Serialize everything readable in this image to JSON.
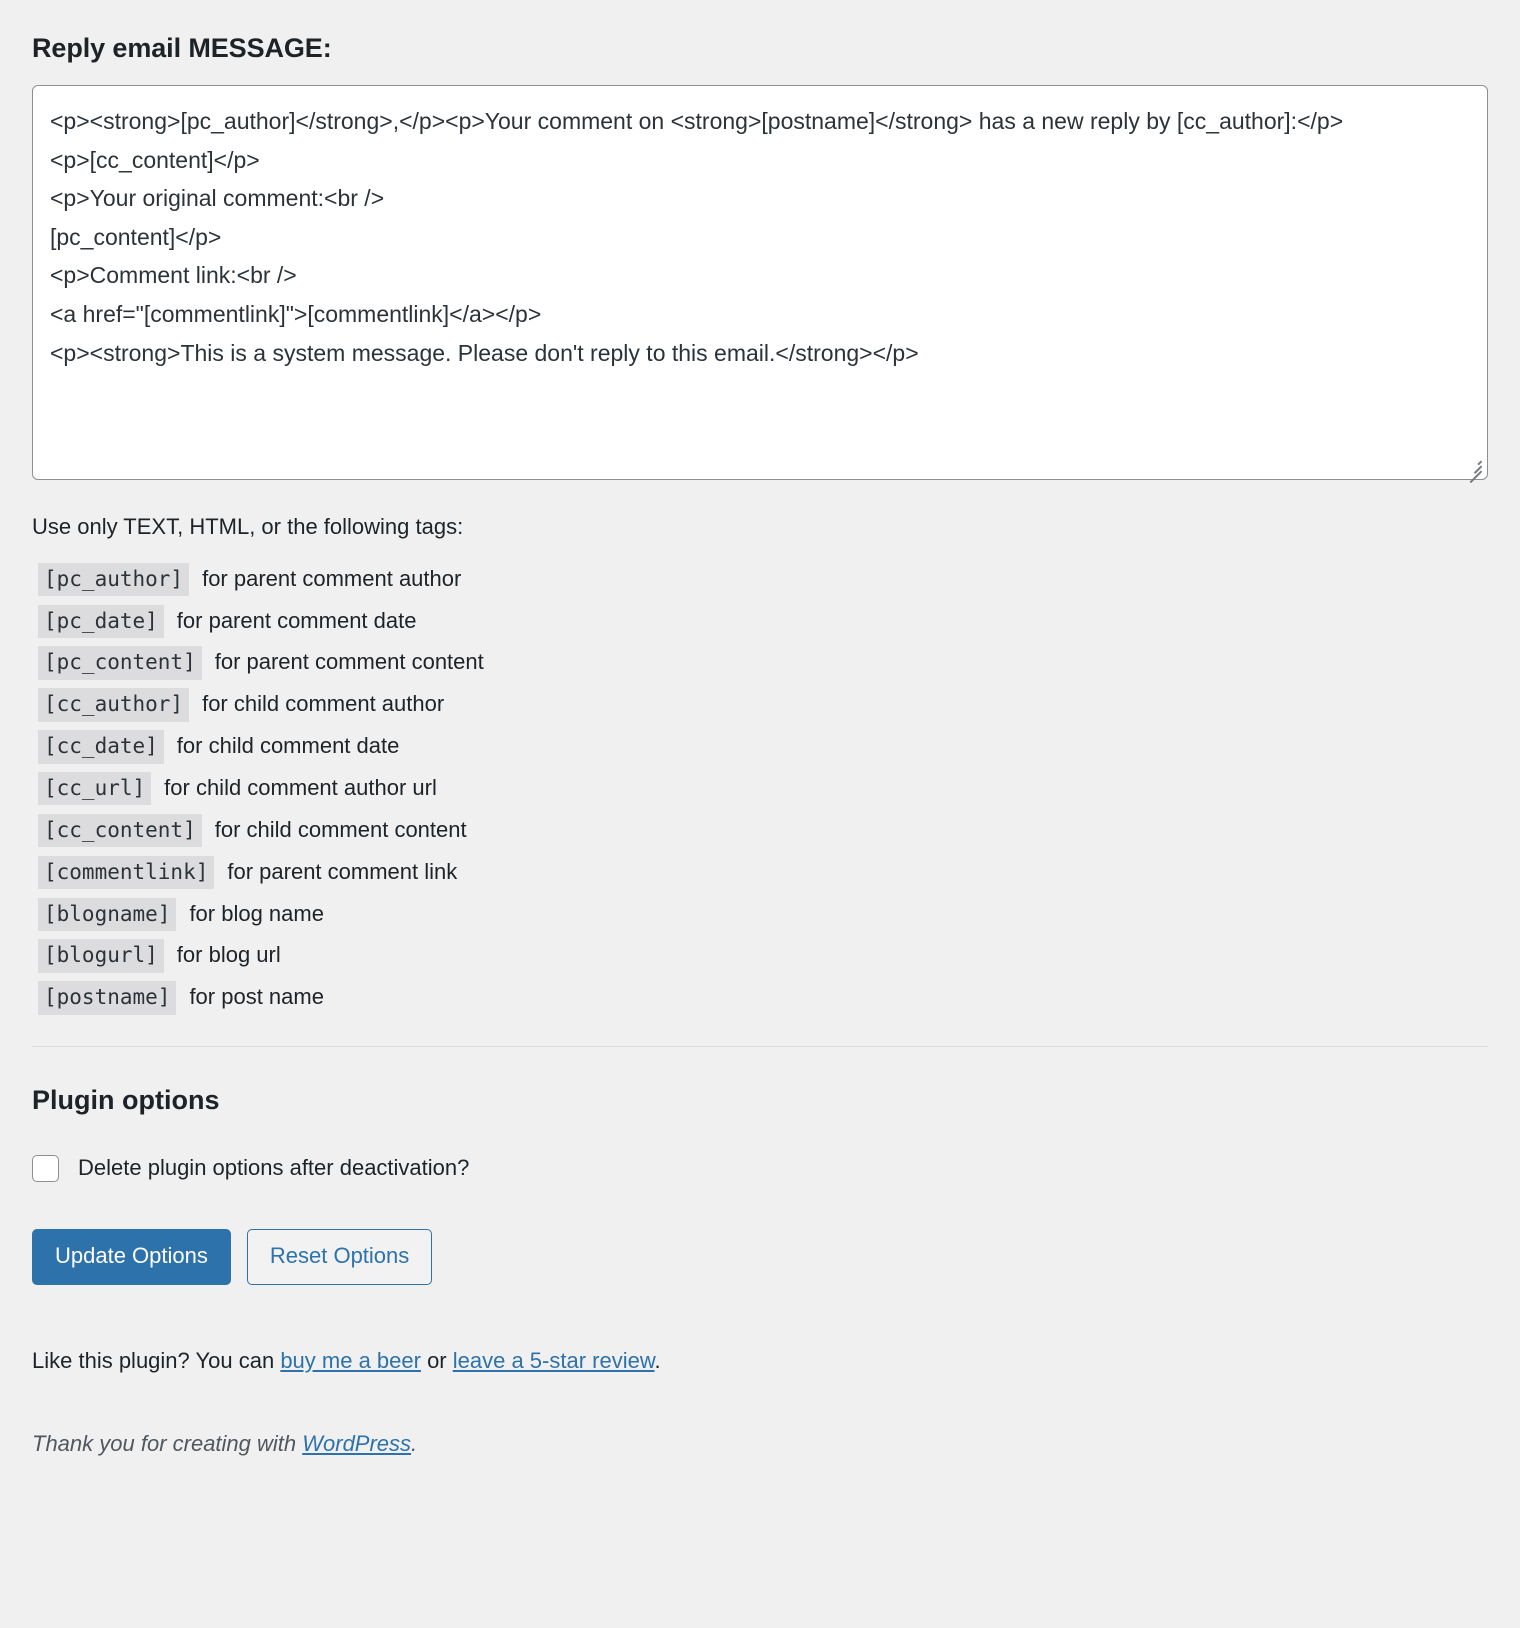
{
  "message_section": {
    "title": "Reply email MESSAGE:",
    "textarea_value": "<p><strong>[pc_author]</strong>,</p><p>Your comment on <strong>[postname]</strong> has a new reply by [cc_author]:</p>\n<p>[cc_content]</p>\n<p>Your original comment:<br />\n[pc_content]</p>\n<p>Comment link:<br />\n<a href=\"[commentlink]\">[commentlink]</a></p>\n<p><strong>This is a system message. Please don't reply to this email.</strong></p>",
    "helper_text": "Use only TEXT, HTML, or the following tags:"
  },
  "tags": [
    {
      "code": "[pc_author]",
      "desc": "for parent comment author"
    },
    {
      "code": "[pc_date]",
      "desc": "for parent comment date"
    },
    {
      "code": "[pc_content]",
      "desc": "for parent comment content"
    },
    {
      "code": "[cc_author]",
      "desc": "for child comment author"
    },
    {
      "code": "[cc_date]",
      "desc": "for child comment date"
    },
    {
      "code": "[cc_url]",
      "desc": "for child comment author url"
    },
    {
      "code": "[cc_content]",
      "desc": "for child comment content"
    },
    {
      "code": "[commentlink]",
      "desc": "for parent comment link"
    },
    {
      "code": "[blogname]",
      "desc": "for blog name"
    },
    {
      "code": "[blogurl]",
      "desc": "for blog url"
    },
    {
      "code": "[postname]",
      "desc": "for post name"
    }
  ],
  "plugin_options": {
    "title": "Plugin options",
    "delete_checkbox_label": "Delete plugin options after deactivation?",
    "delete_checkbox_checked": false
  },
  "buttons": {
    "update_label": "Update Options",
    "reset_label": "Reset Options"
  },
  "footer": {
    "like_prefix": "Like this plugin? You can ",
    "beer_link": "buy me a beer",
    "between": " or ",
    "review_link": "leave a 5-star review",
    "suffix": ".",
    "credits_prefix": "Thank you for creating with ",
    "credits_link": "WordPress",
    "credits_suffix": "."
  },
  "colors": {
    "accent": "#2d72aa",
    "page_bg": "#f0f0f1",
    "tag_bg": "#dcdcde"
  }
}
